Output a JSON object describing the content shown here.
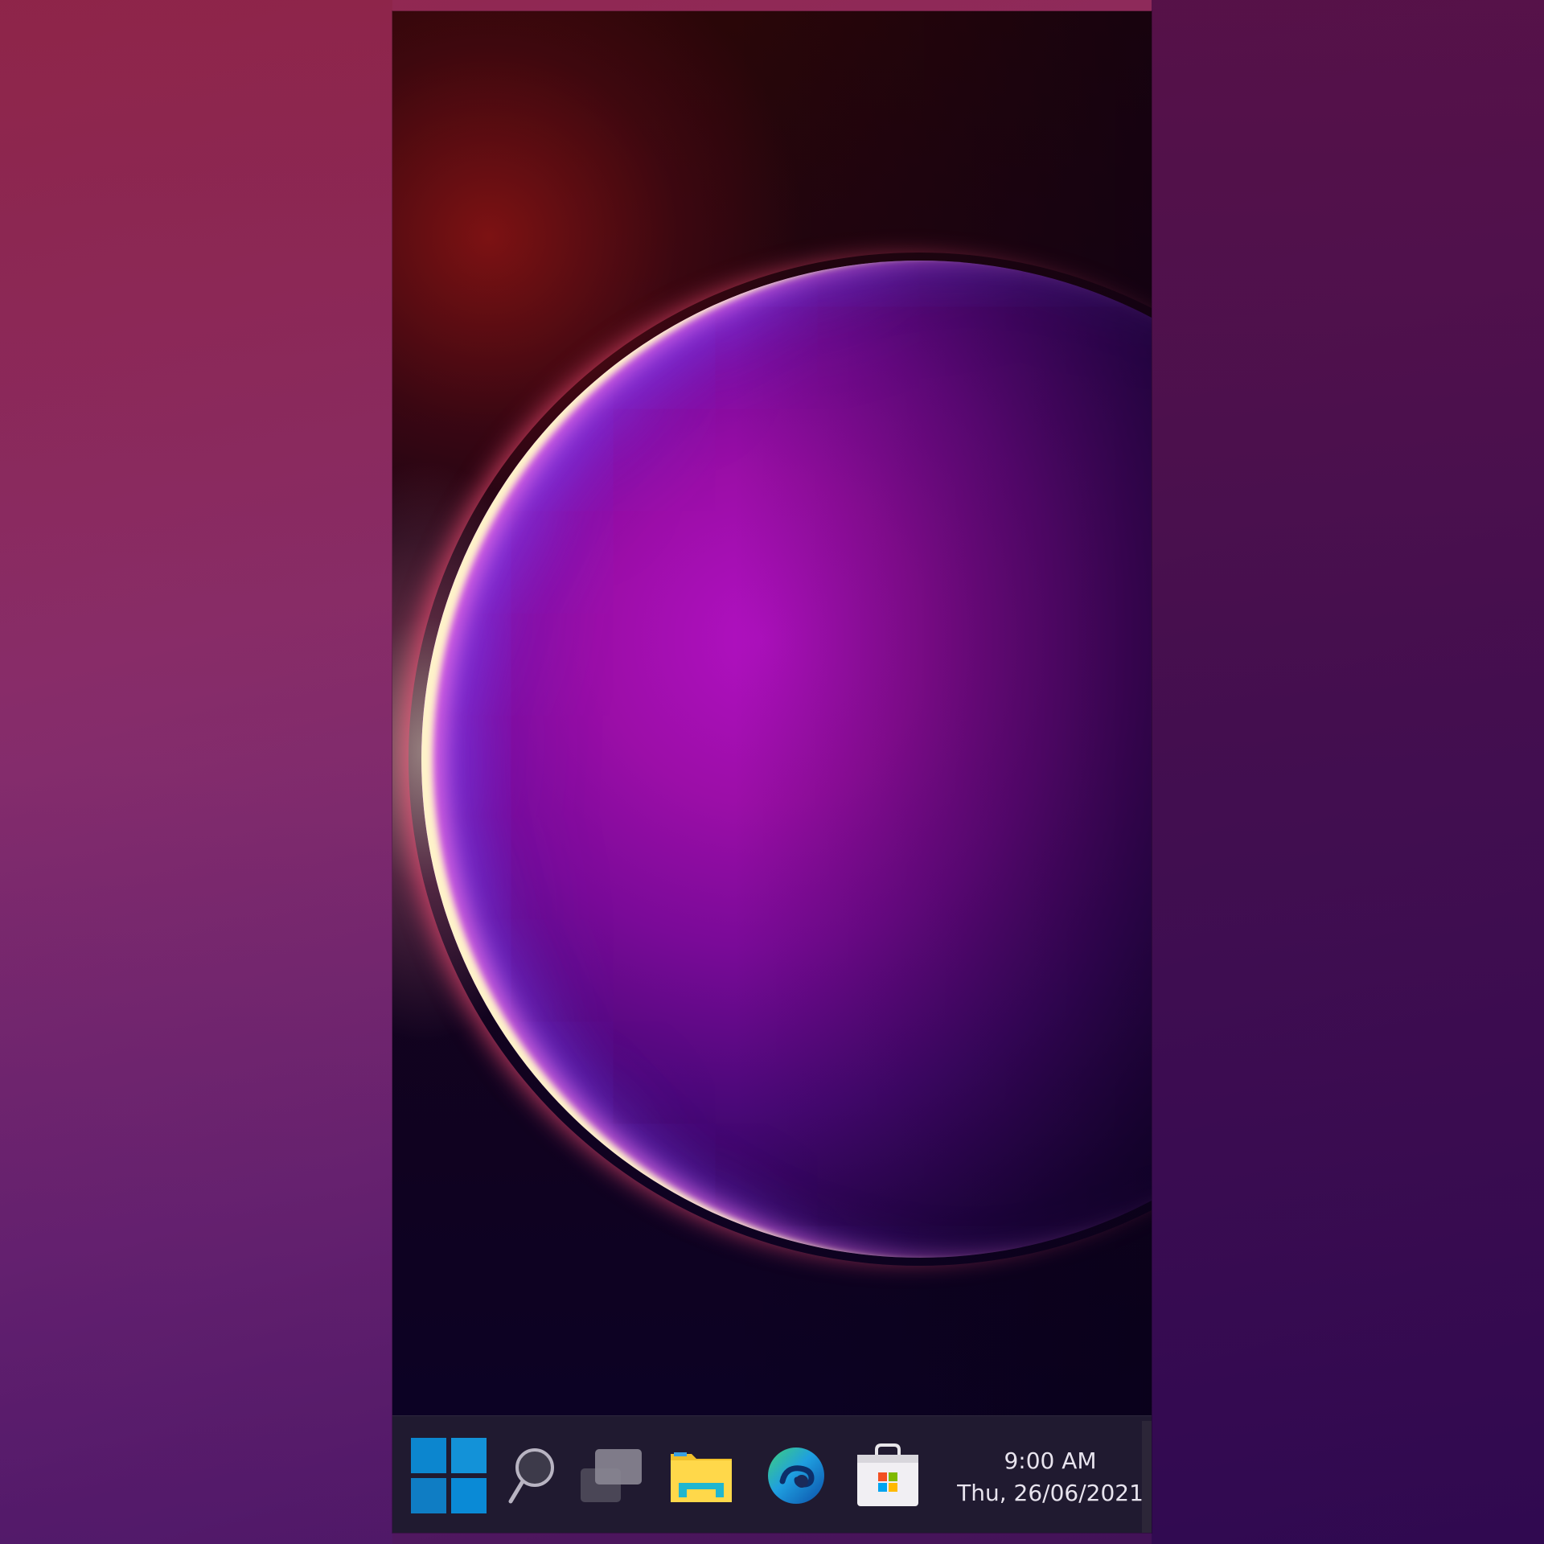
{
  "desktop": {
    "wallpaper": "purple-sphere-wallpaper",
    "colors": {
      "background_top_left": "#92274d",
      "background_bottom_right": "#2e0850",
      "taskbar": "#201a30",
      "sphere_core": "#b010c0",
      "sphere_rim": "#fff6c8"
    }
  },
  "taskbar": {
    "items": [
      {
        "name": "Start",
        "icon": "windows-logo-icon"
      },
      {
        "name": "Search",
        "icon": "search-icon"
      },
      {
        "name": "Task View",
        "icon": "task-view-icon"
      },
      {
        "name": "File Explorer",
        "icon": "folder-icon"
      },
      {
        "name": "Microsoft Edge",
        "icon": "edge-icon"
      },
      {
        "name": "Microsoft Store",
        "icon": "store-bag-icon"
      }
    ],
    "clock": {
      "time": "9:00 AM",
      "date": "Thu, 26/06/2021"
    }
  }
}
